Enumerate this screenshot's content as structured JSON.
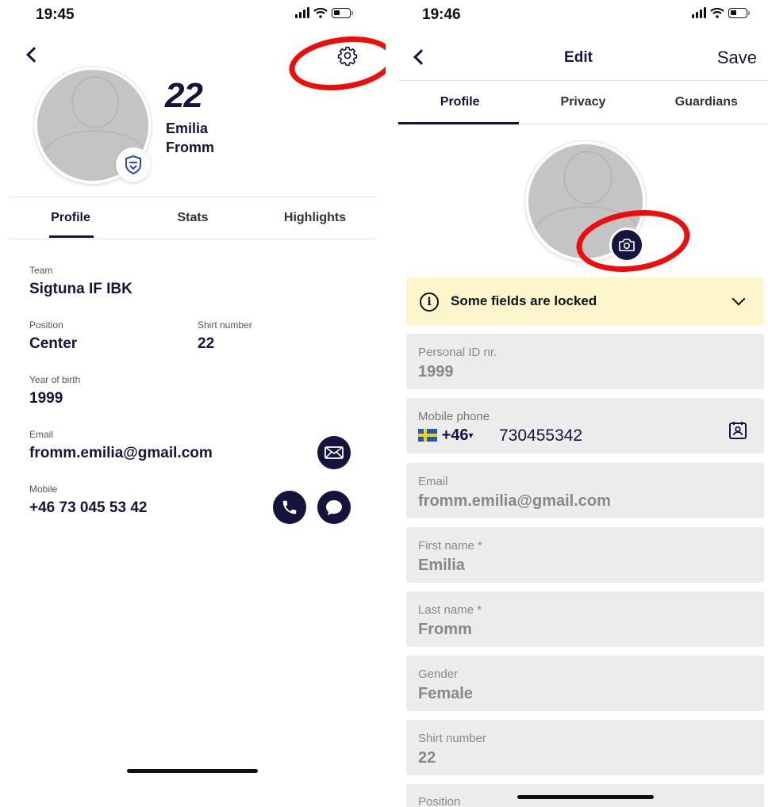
{
  "left_screen": {
    "status_time": "19:45",
    "player": {
      "number": "22",
      "first_name": "Emilia",
      "last_name": "Fromm"
    },
    "tabs": [
      "Profile",
      "Stats",
      "Highlights"
    ],
    "info": {
      "team_label": "Team",
      "team_value": "Sigtuna IF IBK",
      "position_label": "Position",
      "position_value": "Center",
      "shirt_label": "Shirt number",
      "shirt_value": "22",
      "birth_label": "Year of birth",
      "birth_value": "1999",
      "email_label": "Email",
      "email_value": "fromm.emilia@gmail.com",
      "mobile_label": "Mobile",
      "mobile_value": "+46 73 045 53 42"
    }
  },
  "right_screen": {
    "status_time": "19:46",
    "nav": {
      "title": "Edit",
      "save_label": "Save"
    },
    "tabs": [
      "Profile",
      "Privacy",
      "Guardians"
    ],
    "locked_banner": "Some fields are locked",
    "fields": {
      "personal_id": {
        "label": "Personal ID nr.",
        "value": "1999"
      },
      "mobile": {
        "label": "Mobile phone",
        "country_code": "+46",
        "number": "730455342"
      },
      "email": {
        "label": "Email",
        "value": "fromm.emilia@gmail.com"
      },
      "first_name": {
        "label": "First name *",
        "value": "Emilia"
      },
      "last_name": {
        "label": "Last name *",
        "value": "Fromm"
      },
      "gender": {
        "label": "Gender",
        "value": "Female"
      },
      "shirt_number": {
        "label": "Shirt number",
        "value": "22"
      },
      "position": {
        "label": "Position"
      }
    }
  },
  "colors": {
    "primary": "#14143c",
    "annotation": "#ee0c0c",
    "locked_banner_bg": "#fdf6cc",
    "field_bg": "#ececec"
  },
  "icons": [
    "back-chevron-icon",
    "settings-gear-icon",
    "team-shield-icon",
    "mail-icon",
    "phone-icon",
    "chat-icon",
    "camera-icon",
    "info-icon",
    "chevron-down-icon",
    "contact-card-icon",
    "flag-sweden-icon"
  ]
}
